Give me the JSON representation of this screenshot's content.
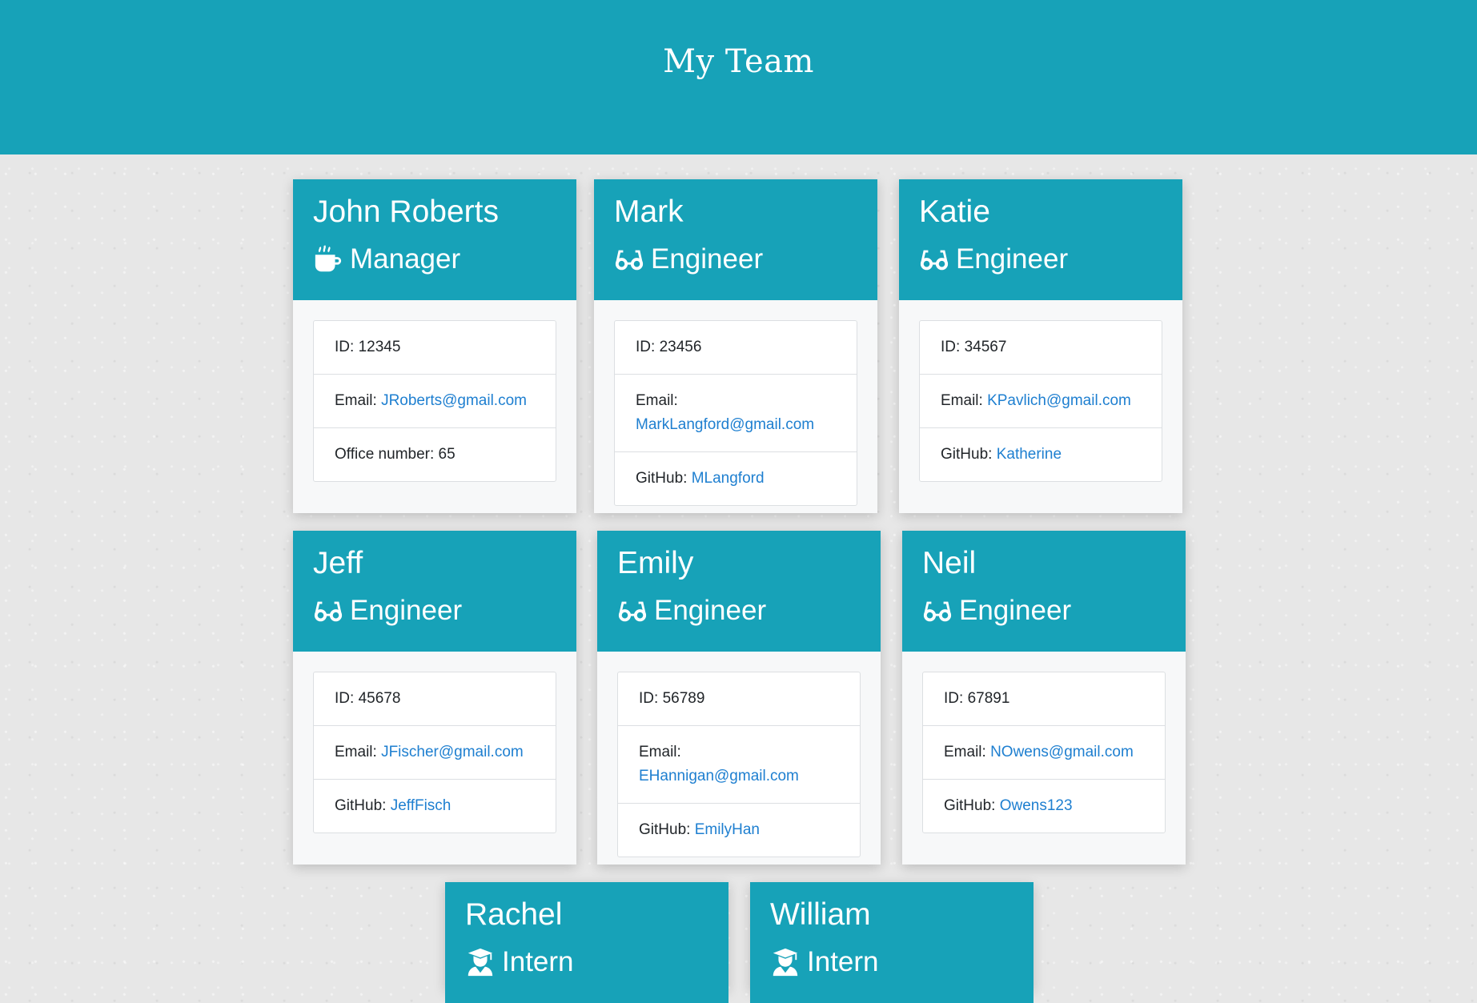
{
  "page": {
    "title": "My Team"
  },
  "team": [
    {
      "name": "John Roberts",
      "role": "Manager",
      "icon": "mug-icon",
      "id_label": "ID: ",
      "id": "12345",
      "email_label": "Email: ",
      "email": "JRoberts@gmail.com",
      "extra_label": "Office number: ",
      "extra": "65"
    },
    {
      "name": "Mark",
      "role": "Engineer",
      "icon": "glasses-icon",
      "id_label": "ID: ",
      "id": "23456",
      "email_label": "Email: ",
      "email": "MarkLangford@gmail.com",
      "extra_label": "GitHub: ",
      "extra": "MLangford"
    },
    {
      "name": "Katie",
      "role": "Engineer",
      "icon": "glasses-icon",
      "id_label": "ID: ",
      "id": "34567",
      "email_label": "Email: ",
      "email": "KPavlich@gmail.com",
      "extra_label": "GitHub: ",
      "extra": "Katherine"
    },
    {
      "name": "Jeff",
      "role": "Engineer",
      "icon": "glasses-icon",
      "id_label": "ID: ",
      "id": "45678",
      "email_label": "Email: ",
      "email": "JFischer@gmail.com",
      "extra_label": "GitHub: ",
      "extra": "JeffFisch"
    },
    {
      "name": "Emily",
      "role": "Engineer",
      "icon": "glasses-icon",
      "id_label": "ID: ",
      "id": "56789",
      "email_label": "Email: ",
      "email": "EHannigan@gmail.com",
      "extra_label": "GitHub: ",
      "extra": "EmilyHan"
    },
    {
      "name": "Neil",
      "role": "Engineer",
      "icon": "glasses-icon",
      "id_label": "ID: ",
      "id": "67891",
      "email_label": "Email: ",
      "email": "NOwens@gmail.com",
      "extra_label": "GitHub: ",
      "extra": "Owens123"
    },
    {
      "name": "Rachel",
      "role": "Intern",
      "icon": "graduate-icon"
    },
    {
      "name": "William",
      "role": "Intern",
      "icon": "graduate-icon"
    }
  ],
  "theme": {
    "header_color": "#17a2b8",
    "link_color": "#1e7fd0"
  }
}
